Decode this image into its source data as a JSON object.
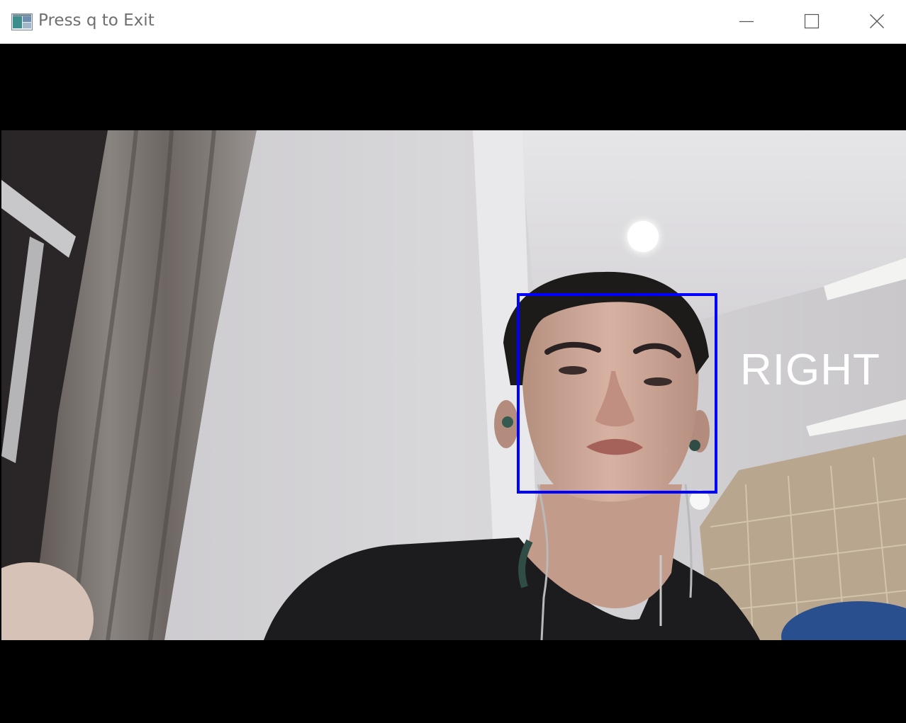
{
  "window": {
    "title": "Press q to Exit",
    "icon": "app-window-icon",
    "controls": [
      "minimize-icon",
      "maximize-icon",
      "close-icon"
    ]
  },
  "video": {
    "label": "RIGHT",
    "box_color": "#0000ff",
    "label_color": "#ffffff"
  }
}
